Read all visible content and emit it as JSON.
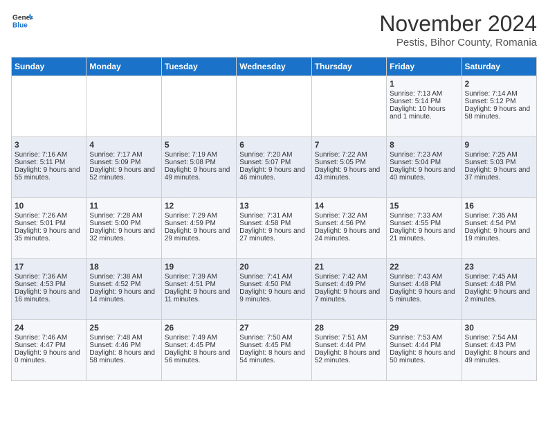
{
  "logo": {
    "line1": "General",
    "line2": "Blue"
  },
  "title": "November 2024",
  "subtitle": "Pestis, Bihor County, Romania",
  "days_header": [
    "Sunday",
    "Monday",
    "Tuesday",
    "Wednesday",
    "Thursday",
    "Friday",
    "Saturday"
  ],
  "weeks": [
    [
      {
        "day": "",
        "data": ""
      },
      {
        "day": "",
        "data": ""
      },
      {
        "day": "",
        "data": ""
      },
      {
        "day": "",
        "data": ""
      },
      {
        "day": "",
        "data": ""
      },
      {
        "day": "1",
        "data": "Sunrise: 7:13 AM\nSunset: 5:14 PM\nDaylight: 10 hours and 1 minute."
      },
      {
        "day": "2",
        "data": "Sunrise: 7:14 AM\nSunset: 5:12 PM\nDaylight: 9 hours and 58 minutes."
      }
    ],
    [
      {
        "day": "3",
        "data": "Sunrise: 7:16 AM\nSunset: 5:11 PM\nDaylight: 9 hours and 55 minutes."
      },
      {
        "day": "4",
        "data": "Sunrise: 7:17 AM\nSunset: 5:09 PM\nDaylight: 9 hours and 52 minutes."
      },
      {
        "day": "5",
        "data": "Sunrise: 7:19 AM\nSunset: 5:08 PM\nDaylight: 9 hours and 49 minutes."
      },
      {
        "day": "6",
        "data": "Sunrise: 7:20 AM\nSunset: 5:07 PM\nDaylight: 9 hours and 46 minutes."
      },
      {
        "day": "7",
        "data": "Sunrise: 7:22 AM\nSunset: 5:05 PM\nDaylight: 9 hours and 43 minutes."
      },
      {
        "day": "8",
        "data": "Sunrise: 7:23 AM\nSunset: 5:04 PM\nDaylight: 9 hours and 40 minutes."
      },
      {
        "day": "9",
        "data": "Sunrise: 7:25 AM\nSunset: 5:03 PM\nDaylight: 9 hours and 37 minutes."
      }
    ],
    [
      {
        "day": "10",
        "data": "Sunrise: 7:26 AM\nSunset: 5:01 PM\nDaylight: 9 hours and 35 minutes."
      },
      {
        "day": "11",
        "data": "Sunrise: 7:28 AM\nSunset: 5:00 PM\nDaylight: 9 hours and 32 minutes."
      },
      {
        "day": "12",
        "data": "Sunrise: 7:29 AM\nSunset: 4:59 PM\nDaylight: 9 hours and 29 minutes."
      },
      {
        "day": "13",
        "data": "Sunrise: 7:31 AM\nSunset: 4:58 PM\nDaylight: 9 hours and 27 minutes."
      },
      {
        "day": "14",
        "data": "Sunrise: 7:32 AM\nSunset: 4:56 PM\nDaylight: 9 hours and 24 minutes."
      },
      {
        "day": "15",
        "data": "Sunrise: 7:33 AM\nSunset: 4:55 PM\nDaylight: 9 hours and 21 minutes."
      },
      {
        "day": "16",
        "data": "Sunrise: 7:35 AM\nSunset: 4:54 PM\nDaylight: 9 hours and 19 minutes."
      }
    ],
    [
      {
        "day": "17",
        "data": "Sunrise: 7:36 AM\nSunset: 4:53 PM\nDaylight: 9 hours and 16 minutes."
      },
      {
        "day": "18",
        "data": "Sunrise: 7:38 AM\nSunset: 4:52 PM\nDaylight: 9 hours and 14 minutes."
      },
      {
        "day": "19",
        "data": "Sunrise: 7:39 AM\nSunset: 4:51 PM\nDaylight: 9 hours and 11 minutes."
      },
      {
        "day": "20",
        "data": "Sunrise: 7:41 AM\nSunset: 4:50 PM\nDaylight: 9 hours and 9 minutes."
      },
      {
        "day": "21",
        "data": "Sunrise: 7:42 AM\nSunset: 4:49 PM\nDaylight: 9 hours and 7 minutes."
      },
      {
        "day": "22",
        "data": "Sunrise: 7:43 AM\nSunset: 4:48 PM\nDaylight: 9 hours and 5 minutes."
      },
      {
        "day": "23",
        "data": "Sunrise: 7:45 AM\nSunset: 4:48 PM\nDaylight: 9 hours and 2 minutes."
      }
    ],
    [
      {
        "day": "24",
        "data": "Sunrise: 7:46 AM\nSunset: 4:47 PM\nDaylight: 9 hours and 0 minutes."
      },
      {
        "day": "25",
        "data": "Sunrise: 7:48 AM\nSunset: 4:46 PM\nDaylight: 8 hours and 58 minutes."
      },
      {
        "day": "26",
        "data": "Sunrise: 7:49 AM\nSunset: 4:45 PM\nDaylight: 8 hours and 56 minutes."
      },
      {
        "day": "27",
        "data": "Sunrise: 7:50 AM\nSunset: 4:45 PM\nDaylight: 8 hours and 54 minutes."
      },
      {
        "day": "28",
        "data": "Sunrise: 7:51 AM\nSunset: 4:44 PM\nDaylight: 8 hours and 52 minutes."
      },
      {
        "day": "29",
        "data": "Sunrise: 7:53 AM\nSunset: 4:44 PM\nDaylight: 8 hours and 50 minutes."
      },
      {
        "day": "30",
        "data": "Sunrise: 7:54 AM\nSunset: 4:43 PM\nDaylight: 8 hours and 49 minutes."
      }
    ]
  ]
}
